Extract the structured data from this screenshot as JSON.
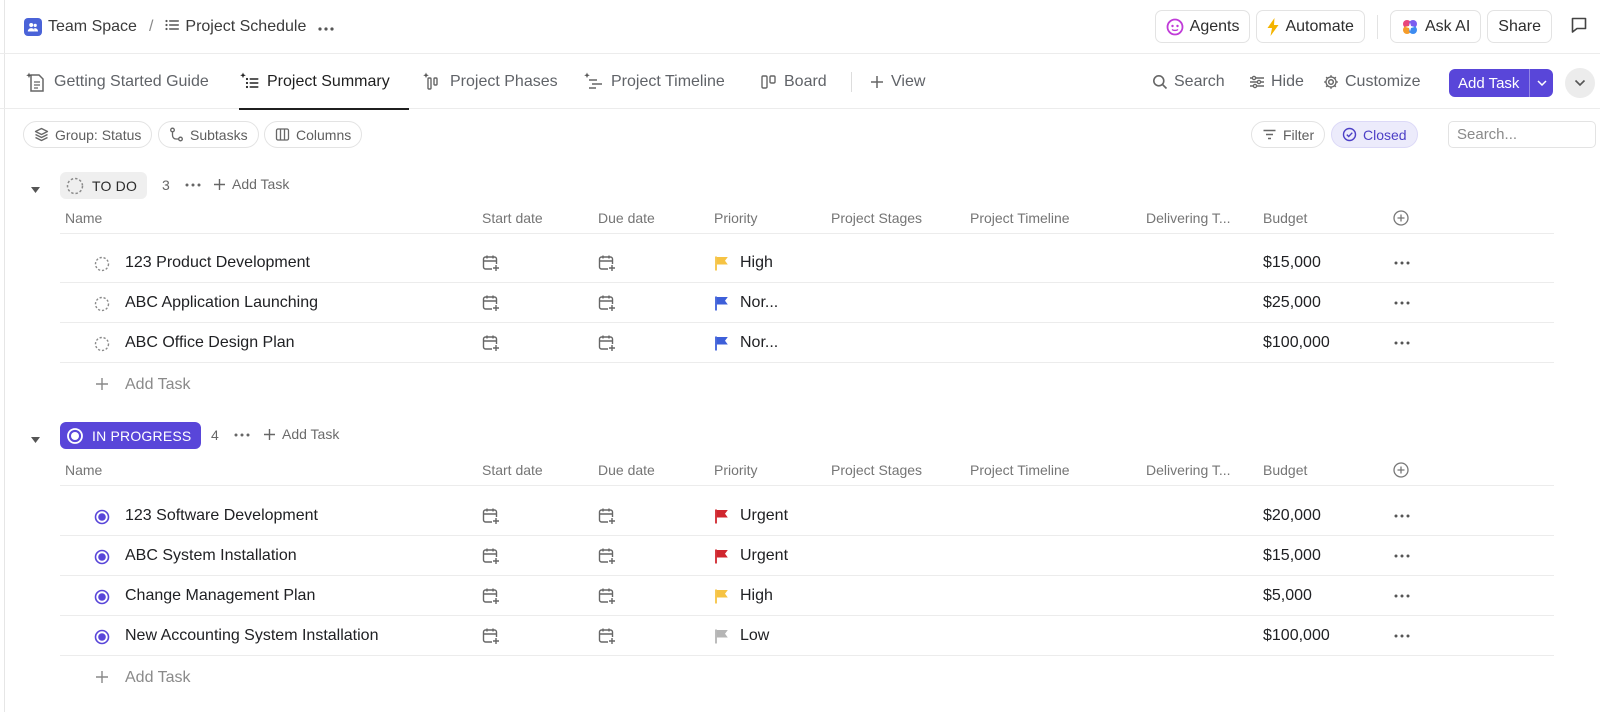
{
  "breadcrumb": {
    "space": "Team Space",
    "separator": "/",
    "page": "Project Schedule"
  },
  "top_actions": {
    "agents": "Agents",
    "automate": "Automate",
    "ask_ai": "Ask AI",
    "share": "Share"
  },
  "tabs": [
    {
      "label": "Getting Started Guide"
    },
    {
      "label": "Project Summary",
      "active": true
    },
    {
      "label": "Project Phases"
    },
    {
      "label": "Project Timeline"
    },
    {
      "label": "Board"
    },
    {
      "label": "View"
    }
  ],
  "view_tools": {
    "search": "Search",
    "hide": "Hide",
    "customize": "Customize",
    "add_task": "Add Task"
  },
  "filters": {
    "group": "Group: Status",
    "subtasks": "Subtasks",
    "columns": "Columns",
    "filter": "Filter",
    "closed": "Closed",
    "search_placeholder": "Search..."
  },
  "columns": {
    "name": "Name",
    "start": "Start date",
    "due": "Due date",
    "priority": "Priority",
    "stages": "Project Stages",
    "timeline": "Project Timeline",
    "delivering": "Delivering T...",
    "budget": "Budget"
  },
  "colors": {
    "accent": "#5946d9",
    "high": "#f6c343",
    "normal": "#3d5fd9",
    "urgent": "#d0262e",
    "low": "#b5b5b5"
  },
  "groups": [
    {
      "status": "TO DO",
      "count": "3",
      "add_label": "Add Task",
      "add_row": "Add Task",
      "tasks": [
        {
          "name": "123 Product Development",
          "priority": "High",
          "budget": "$15,000"
        },
        {
          "name": "ABC Application Launching",
          "priority": "Nor...",
          "budget": "$25,000"
        },
        {
          "name": "ABC Office Design Plan",
          "priority": "Nor...",
          "budget": "$100,000"
        }
      ]
    },
    {
      "status": "IN PROGRESS",
      "count": "4",
      "add_label": "Add Task",
      "add_row": "Add Task",
      "tasks": [
        {
          "name": "123 Software Development",
          "priority": "Urgent",
          "budget": "$20,000"
        },
        {
          "name": "ABC System Installation",
          "priority": "Urgent",
          "budget": "$15,000"
        },
        {
          "name": "Change Management Plan",
          "priority": "High",
          "budget": "$5,000"
        },
        {
          "name": "New Accounting System Installation",
          "priority": "Low",
          "budget": "$100,000"
        }
      ]
    }
  ]
}
